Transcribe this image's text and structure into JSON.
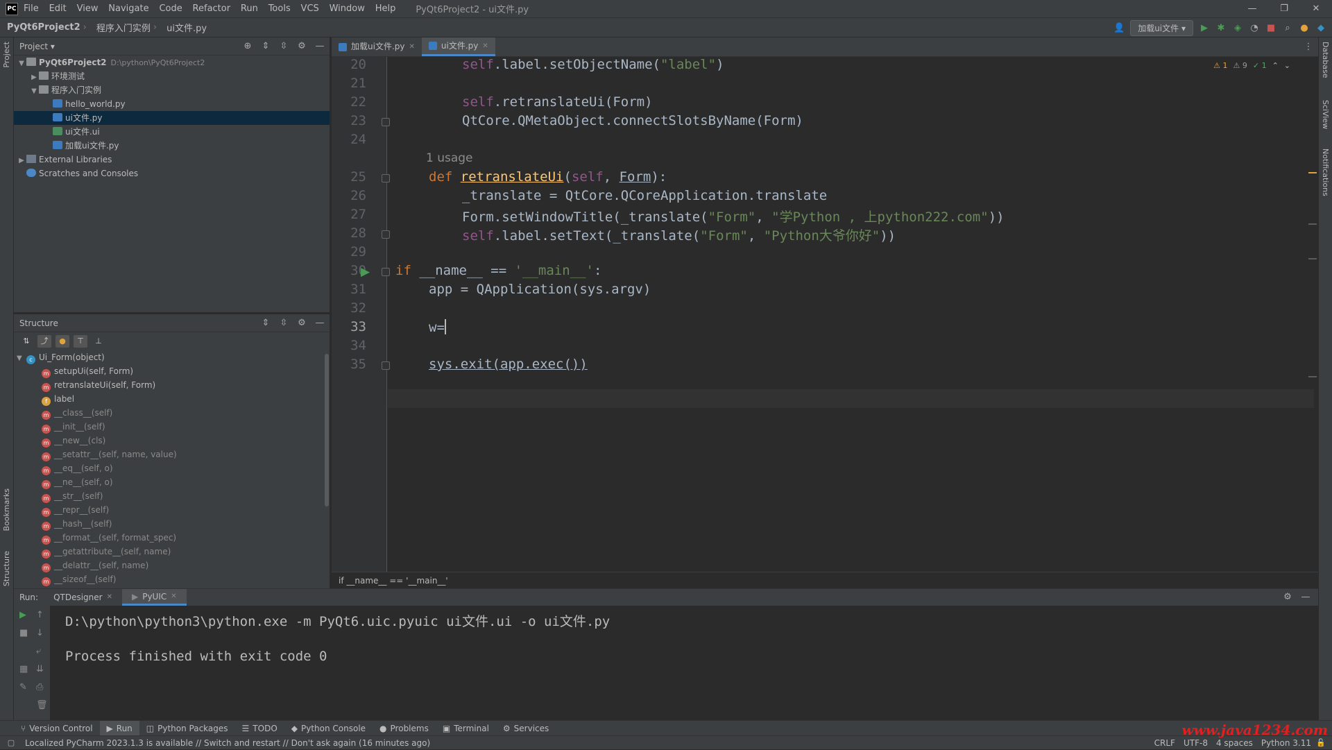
{
  "titlebar": {
    "logo": "PC",
    "menu": [
      "File",
      "Edit",
      "View",
      "Navigate",
      "Code",
      "Refactor",
      "Run",
      "Tools",
      "VCS",
      "Window",
      "Help"
    ],
    "window_title": "PyQt6Project2 - ui文件.py"
  },
  "navbar": {
    "project": "PyQt6Project2",
    "folder": "程序入门实例",
    "file": "ui文件.py",
    "run_config": "加载ui文件"
  },
  "project_panel": {
    "title": "Project",
    "root_name": "PyQt6Project2",
    "root_path": "D:\\python\\PyQt6Project2",
    "items": [
      "环境测试",
      "程序入门实例",
      "hello_world.py",
      "ui文件.py",
      "ui文件.ui",
      "加载ui文件.py",
      "External Libraries",
      "Scratches and Consoles"
    ]
  },
  "structure_panel": {
    "title": "Structure",
    "class_name": "Ui_Form(object)",
    "members": [
      "setupUi(self, Form)",
      "retranslateUi(self, Form)",
      "label",
      "__class__(self)",
      "__init__(self)",
      "__new__(cls)",
      "__setattr__(self, name, value)",
      "__eq__(self, o)",
      "__ne__(self, o)",
      "__str__(self)",
      "__repr__(self)",
      "__hash__(self)",
      "__format__(self, format_spec)",
      "__getattribute__(self, name)",
      "__delattr__(self, name)",
      "__sizeof__(self)"
    ]
  },
  "editor": {
    "tabs": [
      "加载ui文件.py",
      "ui文件.py"
    ],
    "line_numbers": [
      "20",
      "21",
      "22",
      "23",
      "24",
      "25",
      "26",
      "27",
      "28",
      "29",
      "30",
      "31",
      "32",
      "33",
      "34",
      "35"
    ],
    "usage_hint": "1 usage",
    "inspections": {
      "warnings": "1",
      "weak": "9",
      "ok": "1"
    },
    "breadcrumb": "if __name__ == '__main__'"
  },
  "run_panel": {
    "label": "Run:",
    "tabs": [
      "QTDesigner",
      "PyUIC"
    ],
    "command": "D:\\python\\python3\\python.exe -m PyQt6.uic.pyuic ui文件.ui -o ui文件.py",
    "result": "Process finished with exit code 0"
  },
  "bottom_tabs": [
    "Version Control",
    "Run",
    "Python Packages",
    "TODO",
    "Python Console",
    "Problems",
    "Terminal",
    "Services"
  ],
  "statusbar": {
    "message": "Localized PyCharm 2023.1.3 is available // Switch and restart // Don't ask again (16 minutes ago)",
    "line_sep": "CRLF",
    "encoding": "UTF-8",
    "indent": "4 spaces",
    "interpreter": "Python 3.11",
    "watermark": "www.java1234.com"
  },
  "side_labels": {
    "project": "Project",
    "bookmarks": "Bookmarks",
    "structure": "Structure",
    "database": "Database",
    "sciview": "SciView",
    "notifications": "Notifications"
  }
}
